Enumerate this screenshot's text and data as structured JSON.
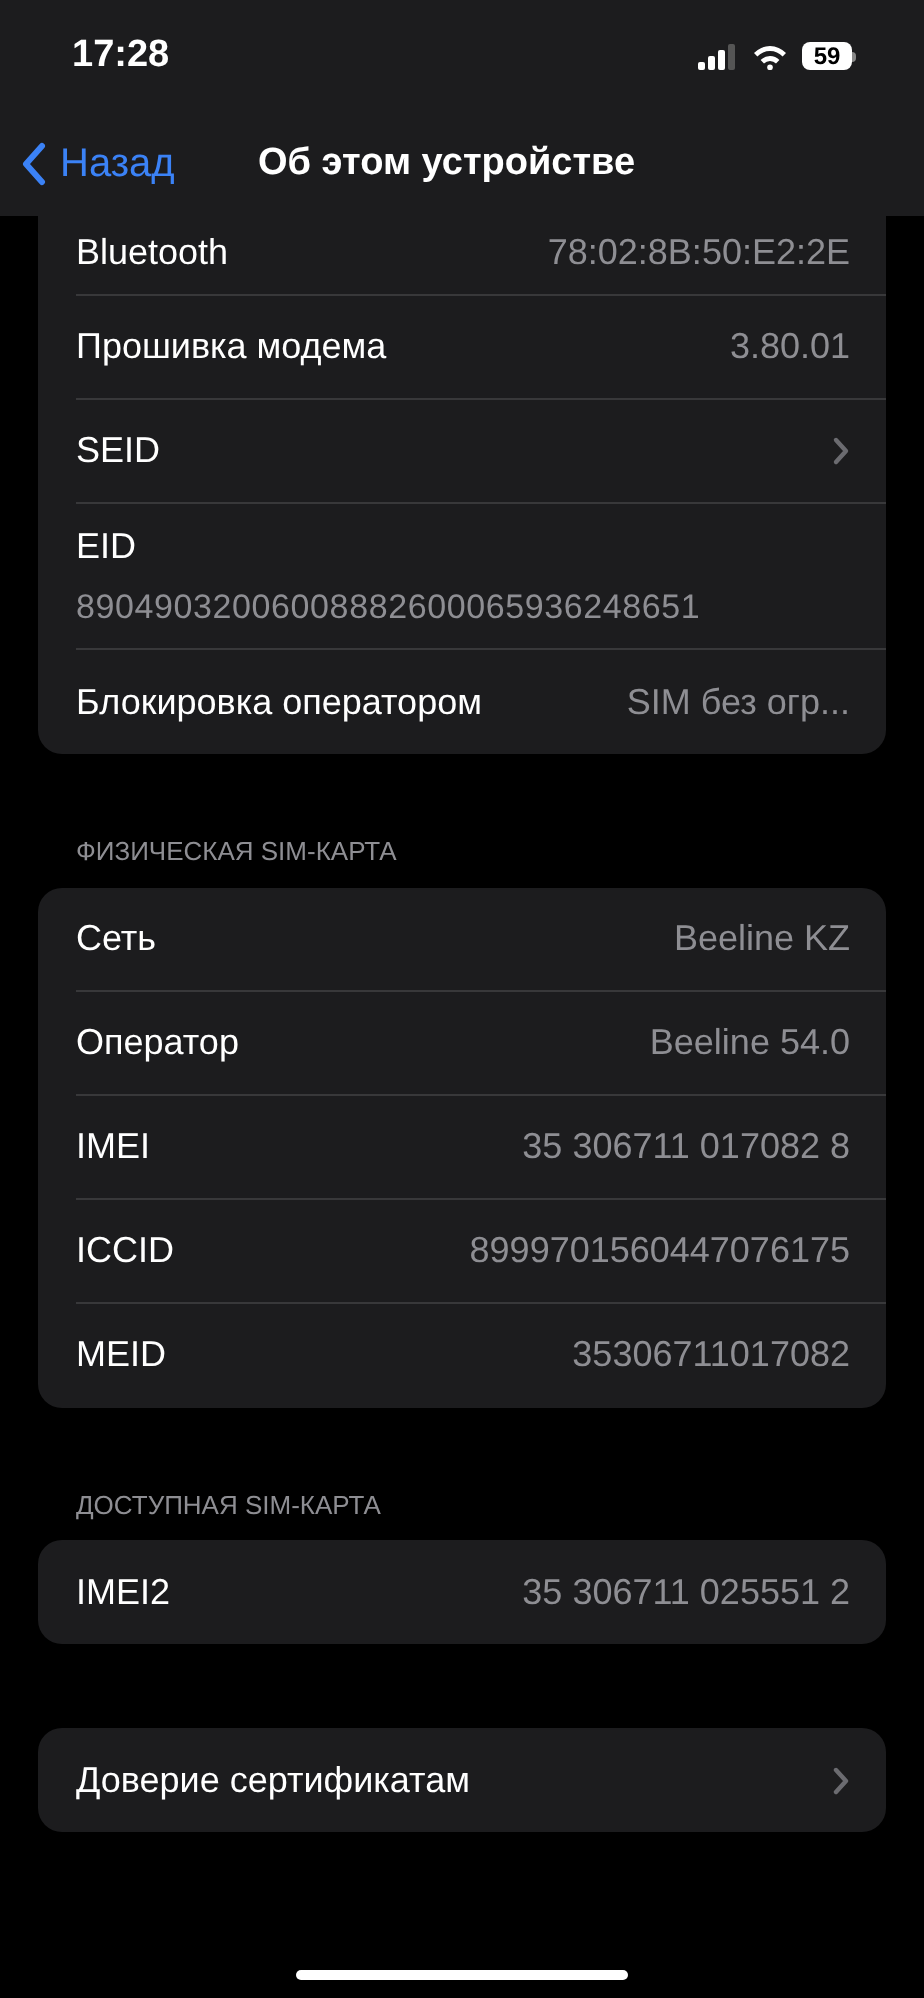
{
  "status_bar": {
    "time": "17:28",
    "battery": "59"
  },
  "nav_bar": {
    "back": "Назад",
    "title": "Об этом устройстве"
  },
  "sections": [
    {
      "rows": [
        {
          "kind": "value",
          "label": "Bluetooth",
          "value": "78:02:8B:50:E2:2E"
        },
        {
          "kind": "value",
          "label": "Прошивка модема",
          "value": "3.80.01"
        },
        {
          "kind": "chevron",
          "label": "SEID"
        },
        {
          "kind": "stacked",
          "label": "EID",
          "value": "89049032006008882600065936248651"
        },
        {
          "kind": "value",
          "label": "Блокировка оператором",
          "value": "SIM без огр..."
        }
      ]
    },
    {
      "header": "ФИЗИЧЕСКАЯ SIM-КАРТА",
      "rows": [
        {
          "kind": "value",
          "label": "Сеть",
          "value": "Beeline KZ"
        },
        {
          "kind": "value",
          "label": "Оператор",
          "value": "Beeline 54.0"
        },
        {
          "kind": "value",
          "label": "IMEI",
          "value": "35 306711 017082 8"
        },
        {
          "kind": "value",
          "label": "ICCID",
          "value": "8999701560447076175"
        },
        {
          "kind": "value",
          "label": "MEID",
          "value": "35306711017082"
        }
      ]
    },
    {
      "header": "ДОСТУПНАЯ SIM-КАРТА",
      "rows": [
        {
          "kind": "value",
          "label": "IMEI2",
          "value": "35 306711 025551 2"
        }
      ]
    },
    {
      "rows": [
        {
          "kind": "chevron",
          "label": "Доверие сертификатам"
        }
      ]
    }
  ]
}
